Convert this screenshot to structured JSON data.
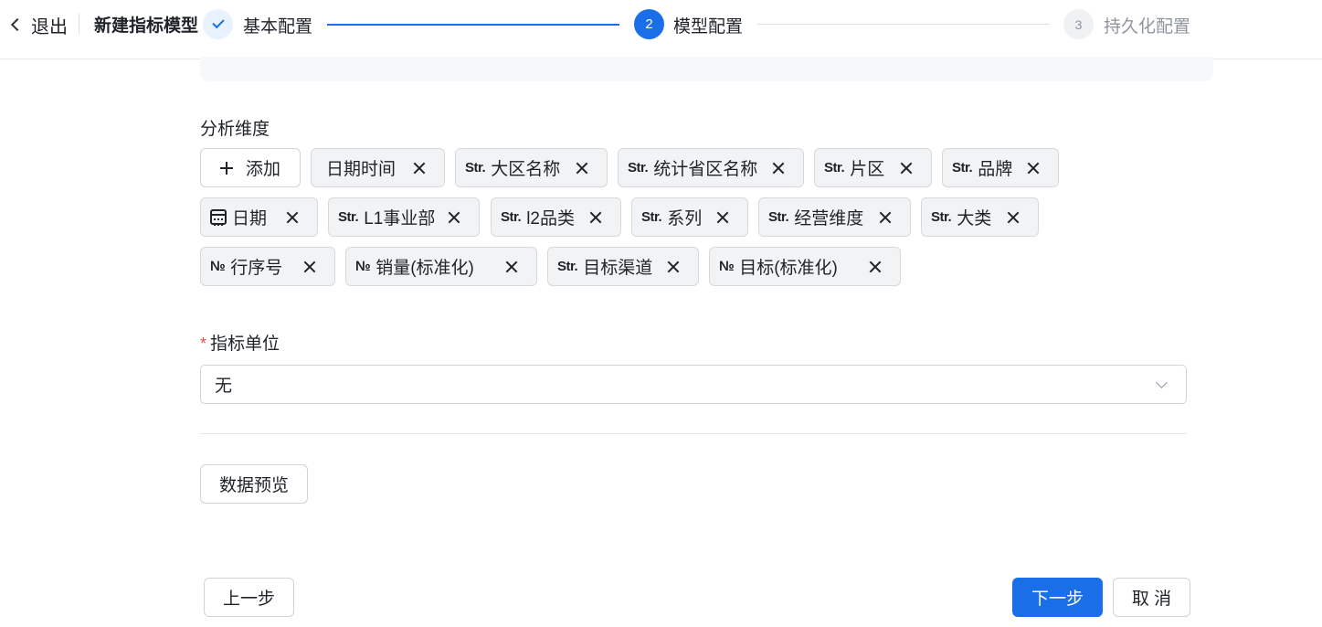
{
  "header": {
    "exit_label": "退出",
    "title": "新建指标模型",
    "steps": [
      {
        "number": "",
        "label": "基本配置",
        "state": "done"
      },
      {
        "number": "2",
        "label": "模型配置",
        "state": "active"
      },
      {
        "number": "3",
        "label": "持久化配置",
        "state": "pending"
      }
    ]
  },
  "dimensions": {
    "label": "分析维度",
    "add_label": "添加",
    "tags": [
      {
        "prefix": "",
        "label": "日期时间"
      },
      {
        "prefix": "Str.",
        "label": "大区名称"
      },
      {
        "prefix": "Str.",
        "label": "统计省区名称"
      },
      {
        "prefix": "Str.",
        "label": "片区"
      },
      {
        "prefix": "Str.",
        "label": "品牌"
      },
      {
        "prefix": "",
        "label": "日期",
        "icon": "calendar-icon"
      },
      {
        "prefix": "Str.",
        "label": "L1事业部"
      },
      {
        "prefix": "Str.",
        "label": "l2品类"
      },
      {
        "prefix": "Str.",
        "label": "系列"
      },
      {
        "prefix": "Str.",
        "label": "经营维度"
      },
      {
        "prefix": "Str.",
        "label": "大类"
      },
      {
        "prefix": "№",
        "label": "行序号"
      },
      {
        "prefix": "№",
        "label": "销量(标准化)"
      },
      {
        "prefix": "Str.",
        "label": "目标渠道"
      },
      {
        "prefix": "№",
        "label": "目标(标准化)"
      }
    ]
  },
  "unit": {
    "required_mark": "*",
    "label": "指标单位",
    "value": "无"
  },
  "buttons": {
    "preview": "数据预览",
    "prev": "上一步",
    "next": "下一步",
    "cancel": "取 消"
  },
  "colors": {
    "primary": "#1a6fe8",
    "required": "#f54a45"
  }
}
